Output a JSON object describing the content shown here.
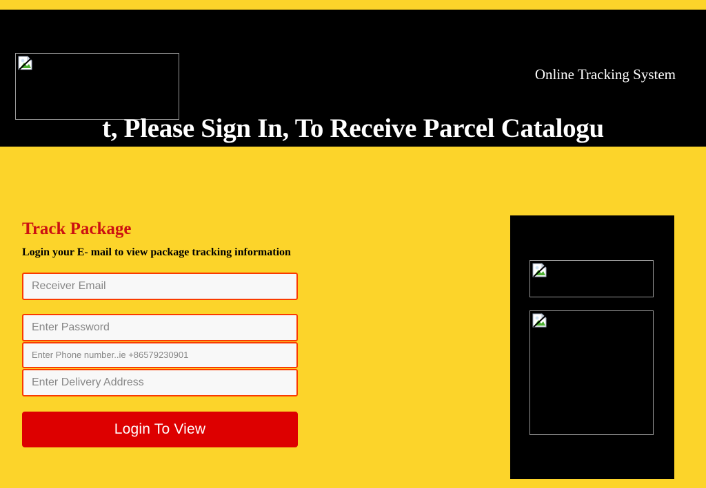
{
  "page": {
    "colors": {
      "brand_yellow": "#fcd42a",
      "header_black": "#000000",
      "accent_red": "#dd0000",
      "heading_red": "#cc1111",
      "input_border": "#fa3b00",
      "input_fill": "#f8f8f8",
      "text_white": "#ffffff",
      "placeholder_gray": "#878787"
    }
  },
  "header": {
    "logo_alt": "broken-image",
    "tagline": "Online Tracking System",
    "title": "t, Please Sign In, To Receive Parcel Catalogu",
    "title_full": "Dear Client, Please Sign In, To Receive Parcel Catalogue"
  },
  "form": {
    "heading": "Track Package",
    "subheading": "Login your E- mail to view package tracking information",
    "fields": [
      {
        "name": "email",
        "placeholder": "Receiver Email",
        "value": "",
        "type": "text"
      },
      {
        "name": "password",
        "placeholder": "Enter Password",
        "value": "",
        "type": "password"
      },
      {
        "name": "phone",
        "placeholder": "Enter Phone number..ie +86579230901",
        "value": "",
        "type": "text"
      },
      {
        "name": "address",
        "placeholder": "Enter Delivery Address",
        "value": "",
        "type": "text"
      }
    ],
    "submit_label": "Login To View"
  },
  "side_panel": {
    "images": [
      {
        "alt": "broken-image"
      },
      {
        "alt": "broken-image"
      }
    ]
  }
}
